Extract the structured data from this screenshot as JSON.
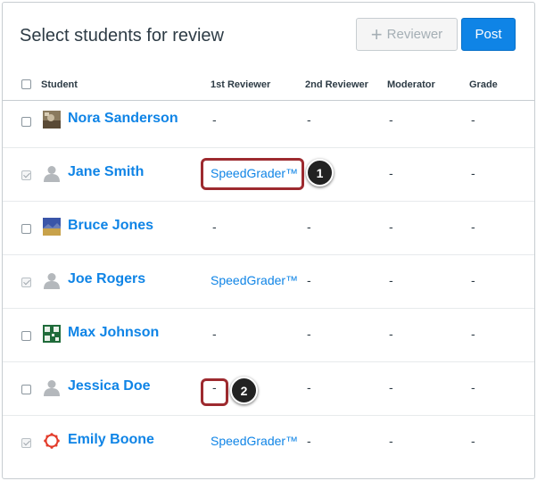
{
  "title": "Select students for review",
  "buttons": {
    "reviewer_label": "Reviewer",
    "post_label": "Post"
  },
  "columns": {
    "student": "Student",
    "first_reviewer": "1st Reviewer",
    "second_reviewer": "2nd Reviewer",
    "moderator": "Moderator",
    "grade": "Grade"
  },
  "rows": [
    {
      "name": "Nora Sanderson",
      "checked": false,
      "avatar": "photo-avatar",
      "first": "-",
      "second": "-",
      "moderator": "-",
      "grade": "-"
    },
    {
      "name": "Jane Smith",
      "checked": true,
      "avatar": "default-user-avatar",
      "first": "SpeedGrader™",
      "second": "-",
      "moderator": "-",
      "grade": "-"
    },
    {
      "name": "Bruce Jones",
      "checked": false,
      "avatar": "photo-avatar",
      "first": "-",
      "second": "-",
      "moderator": "-",
      "grade": "-"
    },
    {
      "name": "Joe Rogers",
      "checked": true,
      "avatar": "default-user-avatar",
      "first": "SpeedGrader™",
      "second": "-",
      "moderator": "-",
      "grade": "-"
    },
    {
      "name": "Max Johnson",
      "checked": false,
      "avatar": "photo-avatar",
      "first": "-",
      "second": "-",
      "moderator": "-",
      "grade": "-"
    },
    {
      "name": "Jessica Doe",
      "checked": false,
      "avatar": "default-user-avatar",
      "first": "-",
      "second": "-",
      "moderator": "-",
      "grade": "-"
    },
    {
      "name": "Emily Boone",
      "checked": true,
      "avatar": "photo-avatar",
      "first": "SpeedGrader™",
      "second": "-",
      "moderator": "-",
      "grade": "-"
    }
  ],
  "callouts": {
    "one": "1",
    "two": "2"
  },
  "colors": {
    "accent": "#0f84e6",
    "highlight": "#9d2a2f",
    "text": "#2d3b45"
  }
}
